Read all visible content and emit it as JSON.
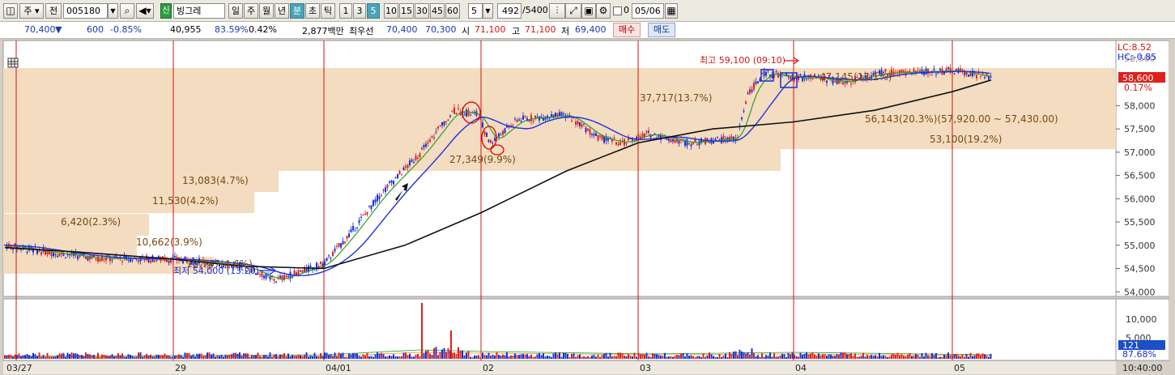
{
  "toolbar": {
    "tab_ju": "주",
    "jeon": "전",
    "code": "005180",
    "badge": "신",
    "name": "빙그레",
    "periods": [
      "일",
      "주",
      "월",
      "년",
      "분",
      "초",
      "틱"
    ],
    "intervals": [
      "1",
      "3",
      "5",
      "10",
      "15",
      "30",
      "45",
      "60"
    ],
    "selected_interval": "5",
    "selected_period": "분",
    "count_select": "5",
    "count_value": "492",
    "count_total": "/5400",
    "zero_label": "0",
    "date": "05/06"
  },
  "quote": {
    "price": "70,400",
    "arrow": "▼",
    "change": "600",
    "change_pct": "-0.85%",
    "volume": "40,955",
    "vol_pct": "83.59%",
    "turnover_pct": "0.42%",
    "amount": "2,877백만",
    "best_label": "최우선",
    "ask": "70,400",
    "bid": "70,300",
    "open_label": "시",
    "open": "71,100",
    "high_label": "고",
    "high": "71,100",
    "low_label": "저",
    "low": "69,400",
    "sell_button": "매수",
    "buy_button": "매도"
  },
  "chart_data": {
    "type": "candlestick",
    "interval": "5분",
    "price_axis": [
      "58,000",
      "57,500",
      "57,000",
      "56,500",
      "56,000",
      "55,500",
      "55,000",
      "54,500",
      "54,000"
    ],
    "price_axis_top_partial": "58,500",
    "volume_axis": [
      "10,000",
      "5,000"
    ],
    "x_labels": [
      "03/27",
      "29",
      "04/01",
      "02",
      "03",
      "04",
      "05"
    ],
    "time_label": "10:40:00",
    "corner_lc": "LC:8.52",
    "corner_hc": "HC:-0.85",
    "current_price_tag": "58,600",
    "current_pct": "0.17%",
    "volume_tag": "121",
    "volume_pct": "87.68%",
    "annotations": {
      "high": "최고 59,100 (09:10)",
      "low": "최저 54,000 (13:20)"
    },
    "price_volume_bands": [
      {
        "label": "6,420(2.3%)"
      },
      {
        "label": "11,530(4.2%)"
      },
      {
        "label": "13,083(4.7%)"
      },
      {
        "label": "10,662(3.9%)"
      },
      {
        "label": "12,747(4.6%)"
      },
      {
        "label": "27,349(9.9%)"
      },
      {
        "label": "37,717(13.7%)"
      },
      {
        "label": "56,143(20.3%)(57,920.00 ~ 57,430.00)"
      },
      {
        "label": "53,100(19.2%)"
      },
      {
        "label": "47,145(17.1%)"
      }
    ],
    "colors": {
      "up": "#e0201c",
      "down": "#1a2fd6",
      "ma_short": "#2aa02a",
      "ma_mid": "#2030e0",
      "ma_long": "#111111",
      "band": "#f3dcc0",
      "vline": "#d21414"
    }
  }
}
